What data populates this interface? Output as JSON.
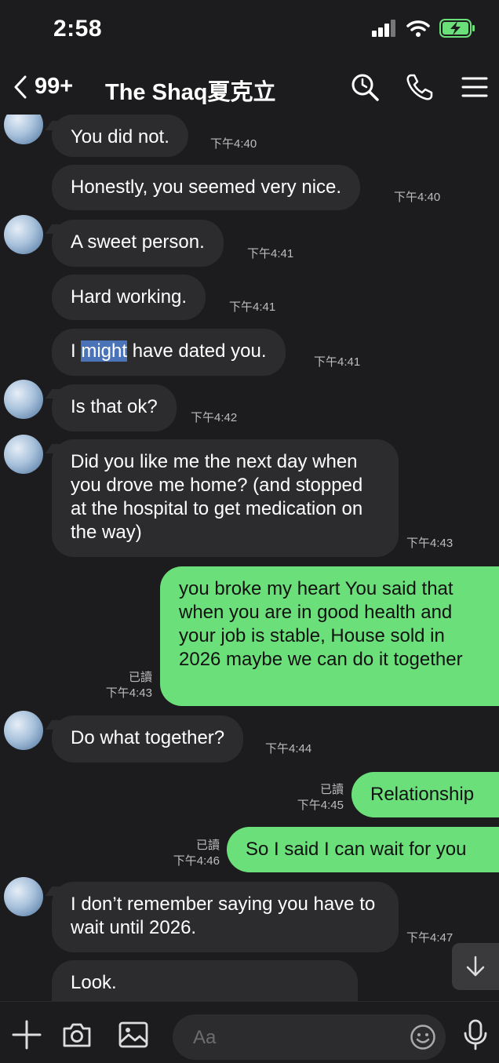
{
  "status": {
    "time": "2:58"
  },
  "header": {
    "back_count": "99+",
    "title": "The Shaq夏克立"
  },
  "messages": [
    {
      "text": "You did not.",
      "time": "下午4:40"
    },
    {
      "text": "Honestly, you seemed very nice.",
      "time": "下午4:40"
    },
    {
      "text": "A sweet person.",
      "time": "下午4:41"
    },
    {
      "text": "Hard working.",
      "time": "下午4:41"
    },
    {
      "pre": "I ",
      "highlight": "might",
      "post": " have dated you.",
      "time": "下午4:41"
    },
    {
      "text": "Is that ok?",
      "time": "下午4:42"
    },
    {
      "text": "Did you like me the next day when you drove me home? (and stopped at the hospital to get medication on the way)",
      "time": "下午4:43"
    },
    {
      "text": "you broke my heart You said that when you are in good health and your job is stable, House sold in 2026 maybe we can do it together",
      "read": "已讀",
      "time": "下午4:43"
    },
    {
      "text": "Do what together?",
      "time": "下午4:44"
    },
    {
      "text": "Relationship",
      "read": "已讀",
      "time": "下午4:45"
    },
    {
      "text": "So I said I can wait for you",
      "read": "已讀",
      "time": "下午4:46"
    },
    {
      "text": "I don’t remember saying you have to wait until 2026.",
      "time": "下午4:47"
    },
    {
      "text": "Look."
    }
  ],
  "input": {
    "placeholder": "Aa"
  }
}
